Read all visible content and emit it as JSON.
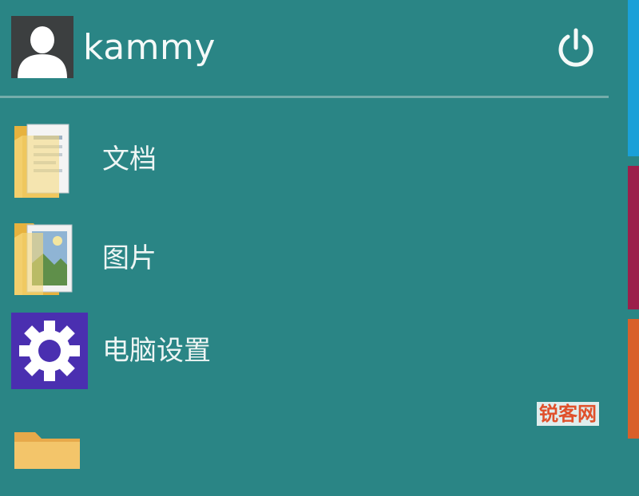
{
  "header": {
    "user_name": "kammy",
    "avatar_icon": "user-avatar-icon",
    "power_icon": "power-icon"
  },
  "menu": {
    "items": [
      {
        "label": "文档",
        "icon": "documents-folder-icon"
      },
      {
        "label": "图片",
        "icon": "pictures-folder-icon"
      },
      {
        "label": "电脑设置",
        "icon": "gear-icon"
      },
      {
        "label": "",
        "icon": "folder-icon"
      }
    ]
  },
  "tiles": {
    "colors": [
      "#1aa0d8",
      "#9c1f4b",
      "#d9602a"
    ]
  },
  "watermark": "锐客网",
  "colors": {
    "background": "#2a8585",
    "divider": "#74adab",
    "settings_tile": "#4a2fb0"
  }
}
